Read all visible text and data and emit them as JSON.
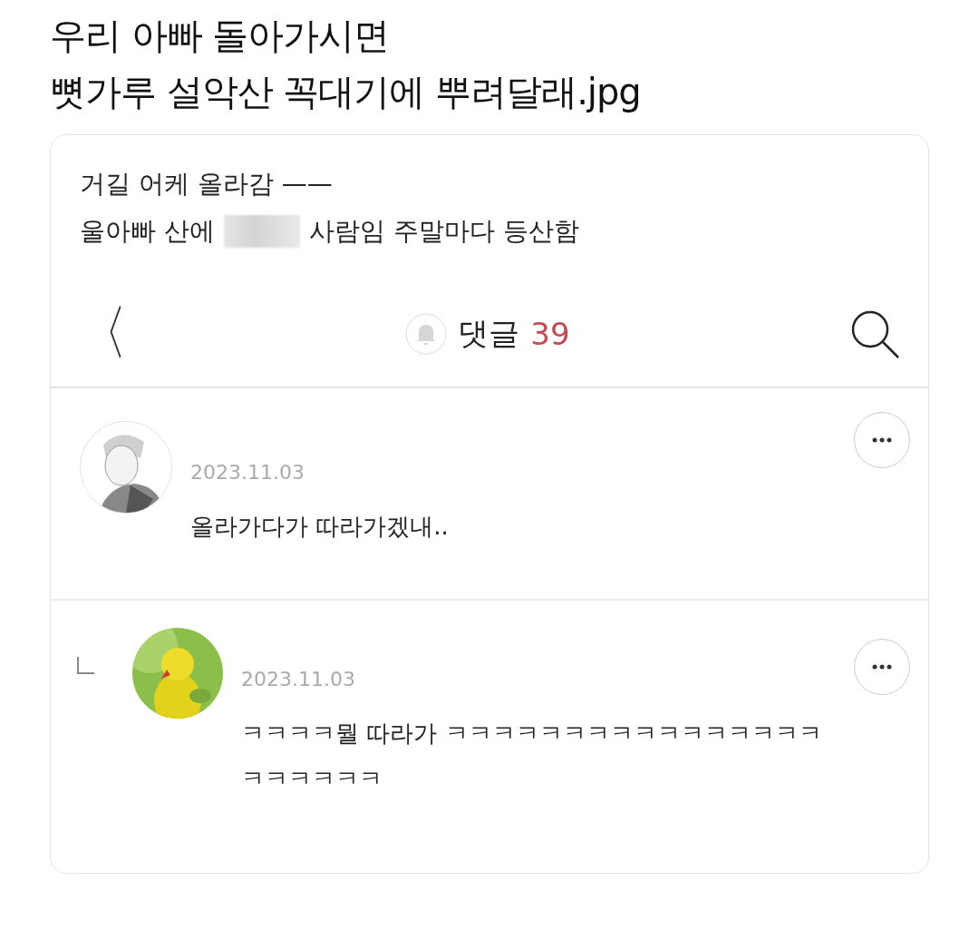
{
  "post_title": {
    "lines": [
      "우리 아빠 돌아가시면",
      "뼛가루 설악산 꼭대기에 뿌려달래.jpg"
    ]
  },
  "caption": {
    "line_1": "거길 어케 올라감 ——",
    "line_2": {
      "before": "울아빠 산에",
      "censored": true,
      "after": "사람임 주말마다 등산함"
    }
  },
  "header": {
    "back": "〈",
    "label": "댓글",
    "count": "39"
  },
  "comments": [
    {
      "kind": "comment",
      "date": "2023.11.03",
      "text": "올라가다가 따라가겠내.."
    },
    {
      "kind": "reply",
      "date": "2023.11.03",
      "text": "ㅋㅋㅋㅋ뭘 따라가 ㅋㅋㅋㅋㅋㅋㅋㅋㅋㅋㅋㅋㅋㅋㅋㅋㅋㅋㅋㅋㅋㅋ"
    }
  ]
}
